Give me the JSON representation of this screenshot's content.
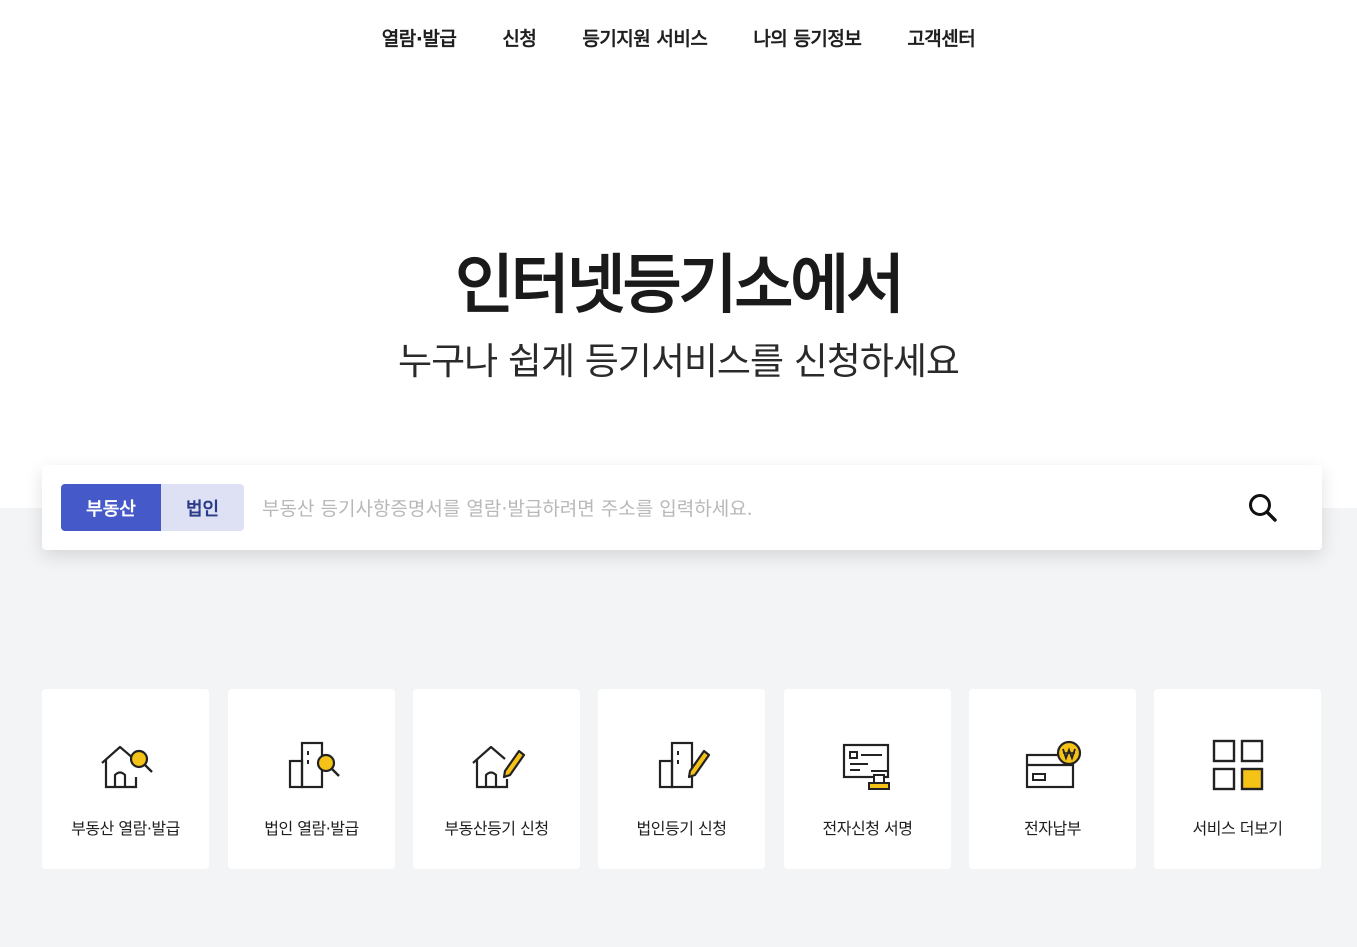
{
  "nav": {
    "items": [
      "열람·발급",
      "신청",
      "등기지원 서비스",
      "나의 등기정보",
      "고객센터"
    ]
  },
  "hero": {
    "title": "인터넷등기소에서",
    "subtitle": "누구나 쉽게 등기서비스를 신청하세요"
  },
  "search": {
    "tabs": [
      "부동산",
      "법인"
    ],
    "active_tab": "부동산",
    "placeholder": "부동산 등기사항증명서를 열람·발급하려면 주소를 입력하세요.",
    "value": ""
  },
  "services": [
    {
      "label": "부동산 열람·발급",
      "icon": "house-search-icon"
    },
    {
      "label": "법인 열람·발급",
      "icon": "building-search-icon"
    },
    {
      "label": "부동산등기 신청",
      "icon": "house-pen-icon"
    },
    {
      "label": "법인등기 신청",
      "icon": "building-pen-icon"
    },
    {
      "label": "전자신청 서명",
      "icon": "e-sign-stamp-icon"
    },
    {
      "label": "전자납부",
      "icon": "card-payment-won-icon"
    },
    {
      "label": "서비스 더보기",
      "icon": "grid-more-icon"
    }
  ],
  "colors": {
    "accent": "#4659c8",
    "accent_light": "#dde1f3",
    "icon_yellow": "#f5c218",
    "band_gray": "#f3f4f6"
  }
}
